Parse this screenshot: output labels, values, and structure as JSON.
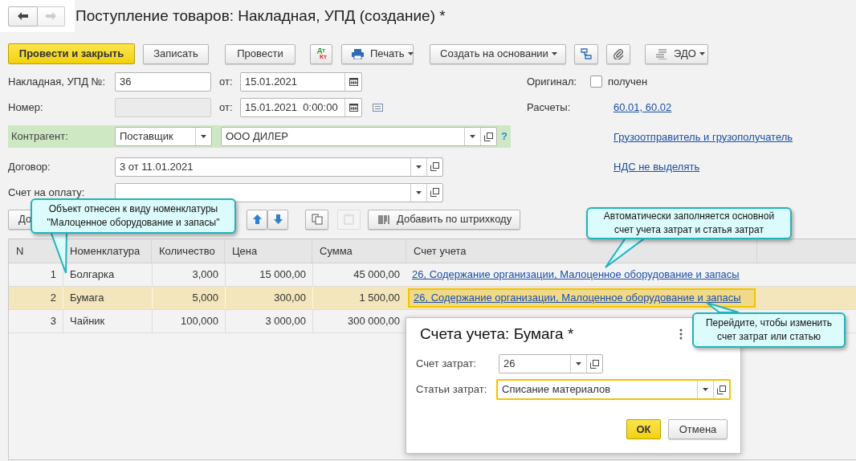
{
  "title": "Поступление товаров: Накладная, УПД (создание) *",
  "toolbar": {
    "post_close": "Провести и закрыть",
    "save": "Записать",
    "post": "Провести",
    "dt": "Дт",
    "kt": "Кт",
    "print": "Печать",
    "create_based": "Создать на основании",
    "edo": "ЭДО"
  },
  "form": {
    "invoice": {
      "label": "Накладная, УПД №:",
      "value": "36",
      "date_label": "от:",
      "date": "15.01.2021"
    },
    "number": {
      "label": "Номер:",
      "disabled": true,
      "date_label": "от:",
      "date": "15.01.2021  0:00:00"
    },
    "counterparty": {
      "label": "Контрагент:",
      "role": "Поставщик",
      "value": "ООО ДИЛЕР",
      "help": "?"
    },
    "contract": {
      "label": "Договор:",
      "value": "3 от 11.01.2021"
    },
    "payment_invoice": {
      "label": "Счет на оплату:"
    },
    "original": {
      "label": "Оригинал:",
      "checkbox_label": "получен",
      "checked": false
    },
    "settlements": {
      "label": "Расчеты:",
      "link": "60.01, 60.02"
    },
    "links": [
      "Грузоотправитель и грузополучатель",
      "НДС не выделять"
    ]
  },
  "table_toolbar": {
    "add": "До",
    "barcode": "Добавить по штрихкоду"
  },
  "table": {
    "columns": [
      "N",
      "Номенклатура",
      "Количество",
      "Цена",
      "Сумма",
      "Счет учета"
    ],
    "rows": [
      {
        "n": "1",
        "item": "Болгарка",
        "qty": "3,000",
        "price": "15 000,00",
        "sum": "45 000,00",
        "account": "26, Содержание организации, Малоценное оборудование и запасы",
        "selected": false
      },
      {
        "n": "2",
        "item": "Бумага",
        "qty": "5,000",
        "price": "300,00",
        "sum": "1 500,00",
        "account": "26, Содержание организации, Малоценное оборудование и запасы",
        "selected": true
      },
      {
        "n": "3",
        "item": "Чайник",
        "qty": "100,000",
        "price": "3 000,00",
        "sum": "300 000,00",
        "selected": false
      }
    ]
  },
  "dialog": {
    "title": "Счета учета: Бумага *",
    "fields": [
      {
        "label": "Счет затрат:",
        "value": "26",
        "focused": false
      },
      {
        "label": "Статьи затрат:",
        "value": "Списание материалов",
        "focused": true
      }
    ],
    "ok": "ОК",
    "cancel": "Отмена"
  },
  "callouts": [
    "Объект отнесен к виду номенклатуры\n\"Малоценное оборудование и запасы\"",
    "Автоматически заполняется основной\nсчет учета затрат и статья затрат",
    "Перейдите, чтобы изменить\nсчет затрат или статью"
  ]
}
